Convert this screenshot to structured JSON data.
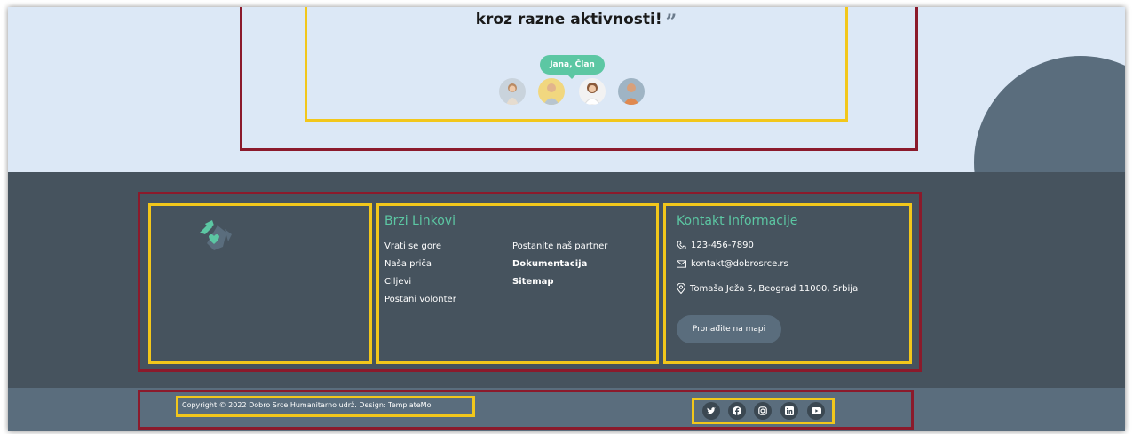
{
  "testimonial": {
    "quote_text": "kroz razne aktivnosti!",
    "quote_mark": "”",
    "active_author": "Jana, Član"
  },
  "footer": {
    "quick_links": {
      "title": "Brzi Linkovi",
      "col1": [
        "Vrati se gore",
        "Naša priča",
        "Ciljevi",
        "Postani volonter"
      ],
      "col2": [
        "Postanite naš partner",
        "Dokumentacija",
        "Sitemap"
      ]
    },
    "contact": {
      "title": "Kontakt Informacije",
      "phone": "123-456-7890",
      "email": "kontakt@dobrosrce.rs",
      "address": "Tomaša Ježa 5, Beograd 11000, Srbija",
      "map_button": "Pronađite na mapi"
    },
    "copyright": "Copyright © 2022 Dobro Srce Humanitarno udrž. Design: TemplateMo",
    "social_icons": [
      "twitter-icon",
      "facebook-icon",
      "instagram-icon",
      "linkedin-icon",
      "youtube-icon"
    ]
  },
  "colors": {
    "accent": "#5cc7a3",
    "footer_bg": "#46535e",
    "bottom_bg": "#5a6d7d",
    "section_bg": "#dce8f6",
    "outline_red": "#8b1a2b",
    "outline_yellow": "#f2c71b"
  }
}
